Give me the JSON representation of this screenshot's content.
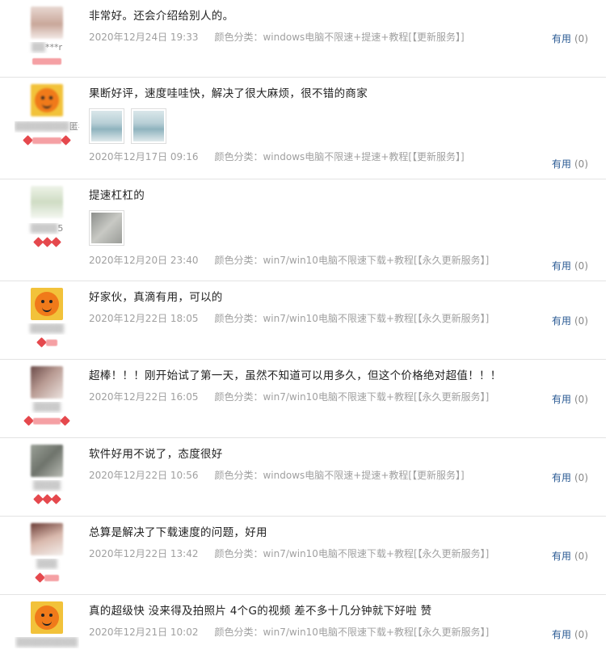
{
  "reviews": [
    {
      "avatar": "photo-avatar",
      "user": "***r",
      "text": "非常好。还会介绍给别人的。",
      "date": "2020年12月24日 19:33",
      "sku": "颜色分类：windows电脑不限速+提速+教程[【更新服务】]",
      "useful_label": "有用",
      "useful_count": "(0)",
      "images": []
    },
    {
      "avatar": "emoji-avatar",
      "user": "匿名)",
      "text": "果断好评，速度哇哇快，解决了很大麻烦，很不错的商家",
      "date": "2020年12月17日 09:16",
      "sku": "颜色分类：windows电脑不限速+提速+教程[【更新服务】]",
      "useful_label": "有用",
      "useful_count": "(0)",
      "images": [
        "screenshot-thumbnail",
        "screenshot-thumbnail"
      ]
    },
    {
      "avatar": "photo-avatar",
      "user": "5",
      "text": "提速杠杠的",
      "date": "2020年12月20日 23:40",
      "sku": "颜色分类：win7/win10电脑不限速下载+教程[【永久更新服务】]",
      "useful_label": "有用",
      "useful_count": "(0)",
      "images": [
        "photo-thumbnail"
      ]
    },
    {
      "avatar": "emoji-avatar",
      "user": "",
      "text": "好家伙，真滴有用，可以的",
      "date": "2020年12月22日 18:05",
      "sku": "颜色分类：win7/win10电脑不限速下载+教程[【永久更新服务】]",
      "useful_label": "有用",
      "useful_count": "(0)",
      "images": []
    },
    {
      "avatar": "photo-avatar",
      "user": "",
      "text": "超棒！！！刚开始试了第一天，虽然不知道可以用多久，但这个价格绝对超值！！！",
      "date": "2020年12月22日 16:05",
      "sku": "颜色分类：win7/win10电脑不限速下载+教程[【永久更新服务】]",
      "useful_label": "有用",
      "useful_count": "(0)",
      "images": []
    },
    {
      "avatar": "photo-avatar",
      "user": "",
      "text": "软件好用不说了，态度很好",
      "date": "2020年12月22日 10:56",
      "sku": "颜色分类：windows电脑不限速+提速+教程[【更新服务】]",
      "useful_label": "有用",
      "useful_count": "(0)",
      "images": []
    },
    {
      "avatar": "photo-avatar",
      "user": "",
      "text": "总算是解决了下载速度的问题，好用",
      "date": "2020年12月22日 13:42",
      "sku": "颜色分类：win7/win10电脑不限速下载+教程[【永久更新服务】]",
      "useful_label": "有用",
      "useful_count": "(0)",
      "images": []
    },
    {
      "avatar": "emoji-avatar",
      "user": "",
      "text": "真的超级快 没来得及拍照片 4个G的视频 差不多十几分钟就下好啦 赞",
      "date": "2020年12月21日 10:02",
      "sku": "颜色分类：win7/win10电脑不限速下载+教程[【永久更新服务】]",
      "useful_label": "有用",
      "useful_count": "(0)",
      "images": []
    }
  ]
}
